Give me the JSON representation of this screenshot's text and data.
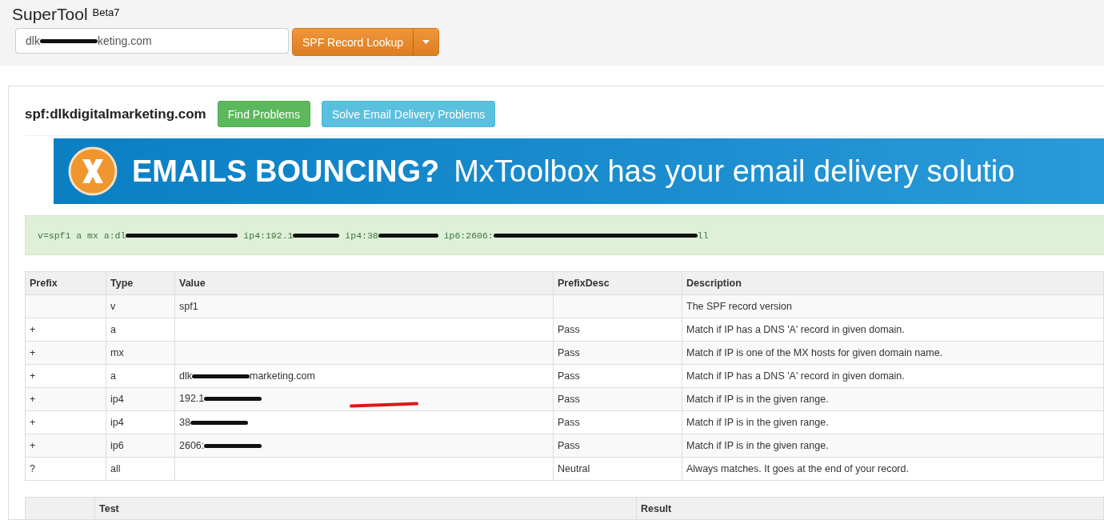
{
  "header": {
    "title": "SuperTool",
    "badge": "Beta7",
    "search": {
      "value_parts": [
        {
          "kind": "text",
          "text": "dlk"
        },
        {
          "kind": "redaction"
        },
        {
          "kind": "text",
          "text": "keting.com"
        }
      ]
    },
    "lookup_button": "SPF Record Lookup"
  },
  "result": {
    "title": "spf:dlkdigitalmarketing.com",
    "buttons": [
      {
        "label": "Find Problems",
        "kind": "success"
      },
      {
        "label": "Solve Email Delivery Problems",
        "kind": "info"
      }
    ],
    "banner": {
      "headline": "EMAILS BOUNCING?",
      "tagline": "MxToolbox has your email delivery solutio"
    },
    "record_parts": [
      {
        "kind": "text",
        "text": "v=spf1 a mx a:dl"
      },
      {
        "kind": "redaction"
      },
      {
        "kind": "text",
        "text": " ip4:192.1"
      },
      {
        "kind": "redaction"
      },
      {
        "kind": "text",
        "text": " ip4:38"
      },
      {
        "kind": "redaction"
      },
      {
        "kind": "text",
        "text": " ip6:2606:"
      },
      {
        "kind": "redaction"
      },
      {
        "kind": "text",
        "text": "ll"
      }
    ],
    "table": {
      "columns": [
        "Prefix",
        "Type",
        "Value",
        "PrefixDesc",
        "Description"
      ],
      "rows": [
        {
          "prefix": "",
          "type": "v",
          "value_parts": [
            {
              "kind": "text",
              "text": "spf1"
            }
          ],
          "prefix_desc": "",
          "description": "The SPF record version",
          "underlined": false
        },
        {
          "prefix": "+",
          "type": "a",
          "value_parts": [],
          "prefix_desc": "Pass",
          "description": "Match if IP has a DNS 'A' record in given domain.",
          "underlined": false
        },
        {
          "prefix": "+",
          "type": "mx",
          "value_parts": [],
          "prefix_desc": "Pass",
          "description": "Match if IP is one of the MX hosts for given domain name.",
          "underlined": false
        },
        {
          "prefix": "+",
          "type": "a",
          "value_parts": [
            {
              "kind": "text",
              "text": "dlk"
            },
            {
              "kind": "redaction"
            },
            {
              "kind": "text",
              "text": "marketing.com"
            }
          ],
          "prefix_desc": "Pass",
          "description": "Match if IP has a DNS 'A' record in given domain.",
          "underlined": false
        },
        {
          "prefix": "+",
          "type": "ip4",
          "value_parts": [
            {
              "kind": "text",
              "text": "192.1"
            },
            {
              "kind": "redaction"
            }
          ],
          "prefix_desc": "Pass",
          "description": "Match if IP is in the given range.",
          "underlined": true
        },
        {
          "prefix": "+",
          "type": "ip4",
          "value_parts": [
            {
              "kind": "text",
              "text": "38"
            },
            {
              "kind": "redaction"
            }
          ],
          "prefix_desc": "Pass",
          "description": "Match if IP is in the given range.",
          "underlined": false
        },
        {
          "prefix": "+",
          "type": "ip6",
          "value_parts": [
            {
              "kind": "text",
              "text": "2606:"
            },
            {
              "kind": "redaction"
            }
          ],
          "prefix_desc": "Pass",
          "description": "Match if IP is in the given range.",
          "underlined": false
        },
        {
          "prefix": "?",
          "type": "all",
          "value_parts": [],
          "prefix_desc": "Neutral",
          "description": "Always matches. It goes at the end of your record.",
          "underlined": false
        }
      ]
    },
    "test_table": {
      "columns": [
        "Test",
        "Result"
      ]
    }
  }
}
